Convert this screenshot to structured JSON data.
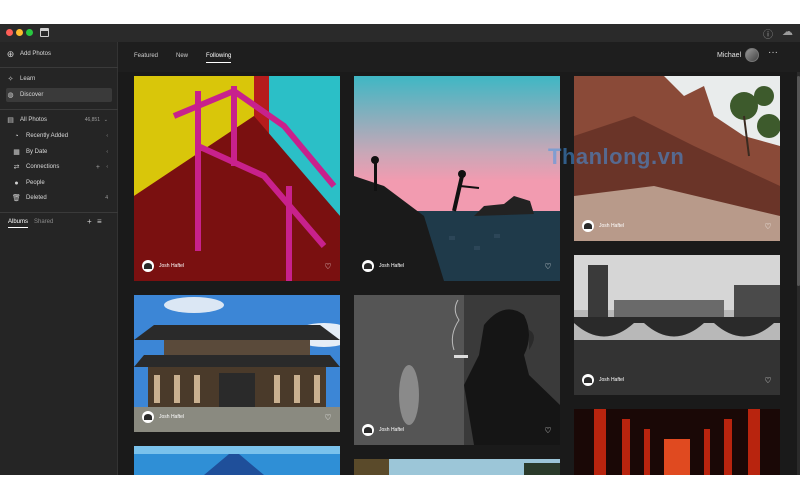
{
  "titlebar": {
    "help_icon": "help-circle-icon",
    "cloud_icon": "cloud-icon",
    "colors": {
      "close": "#ff5f57",
      "min": "#febc2e",
      "max": "#28c840"
    }
  },
  "sidebar": {
    "add_photos": "Add Photos",
    "learn": "Learn",
    "discover": "Discover",
    "all_photos": "All Photos",
    "all_photos_count": "46,851",
    "recently_added": "Recently Added",
    "by_date": "By Date",
    "connections": "Connections",
    "people": "People",
    "deleted": "Deleted",
    "deleted_count": "4",
    "tabs": {
      "albums": "Albums",
      "shared": "Shared"
    }
  },
  "topnav": {
    "tabs": [
      "Featured",
      "New",
      "Following"
    ],
    "active_tab": "Following",
    "user": "Michael"
  },
  "photos": [
    {
      "author": "Josh Haftel",
      "subject": "stairs-railing"
    },
    {
      "author": "Josh Haftel",
      "subject": "sunset-pier"
    },
    {
      "author": "Josh Haftel",
      "subject": "rock-coast"
    },
    {
      "author": "Josh Haftel",
      "subject": "temple"
    },
    {
      "author": "Josh Haftel",
      "subject": "smoker-portrait"
    },
    {
      "author": "Josh Haftel",
      "subject": "city-bridge"
    }
  ],
  "watermark": "Thanlong.vn"
}
